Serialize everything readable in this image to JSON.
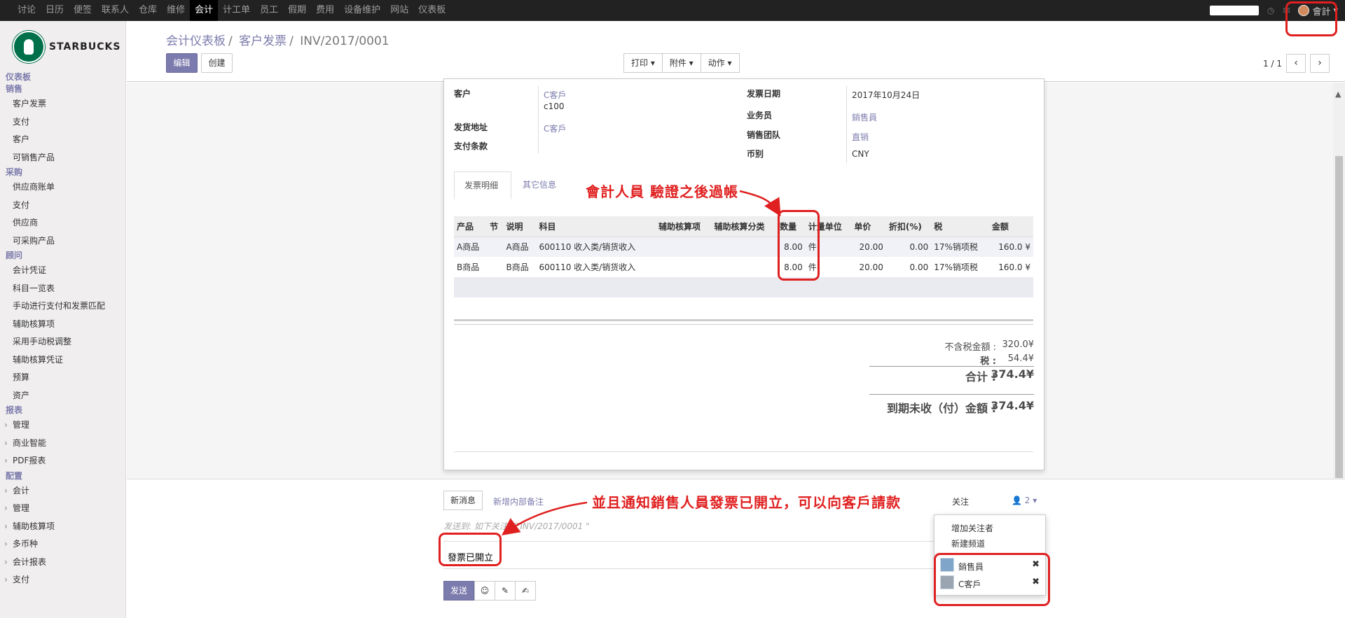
{
  "topnav": {
    "items": [
      "讨论",
      "日历",
      "便签",
      "联系人",
      "仓库",
      "维修",
      "会计",
      "计工单",
      "员工",
      "假期",
      "费用",
      "设备维护",
      "网站",
      "仪表板"
    ],
    "active_index": 6,
    "user": "會計"
  },
  "logo": {
    "text": "STARBUCKS"
  },
  "sidebar": {
    "dashboard": "仪表板",
    "sales": {
      "title": "销售",
      "items": [
        "客户发票",
        "支付",
        "客户",
        "可销售产品"
      ]
    },
    "purchase": {
      "title": "采购",
      "items": [
        "供应商账单",
        "支付",
        "供应商",
        "可采购产品"
      ]
    },
    "advisor": {
      "title": "顾问",
      "items": [
        "会计凭证",
        "科目一览表",
        "手动进行支付和发票匹配",
        "辅助核算项",
        "采用手动税调整",
        "辅助核算凭证",
        "预算",
        "资产"
      ]
    },
    "reports": {
      "title": "报表",
      "items": [
        "管理",
        "商业智能",
        "PDF报表"
      ]
    },
    "config": {
      "title": "配置",
      "items": [
        "会计",
        "管理",
        "辅助核算项",
        "多币种",
        "会计报表",
        "支付"
      ]
    }
  },
  "breadcrumb": {
    "b1": "会计仪表板",
    "b2": "客户发票",
    "current": "INV/2017/0001",
    "sep": "/"
  },
  "buttons": {
    "edit": "编辑",
    "create": "创建",
    "print": "打印 ▾",
    "attach": "附件 ▾",
    "action": "动作 ▾"
  },
  "pager": {
    "text": "1 / 1",
    "prev": "‹",
    "next": "›"
  },
  "invoice": {
    "customer_label": "客户",
    "customer_value": "C客戶",
    "customer_code": "c100",
    "ship_label": "发货地址",
    "ship_value": "C客戶",
    "payterm_label": "支付条款",
    "date_label": "发票日期",
    "date_value": "2017年10月24日",
    "salesperson_label": "业务员",
    "salesperson_value": "銷售員",
    "team_label": "销售团队",
    "team_value": "直销",
    "currency_label": "币别",
    "currency_value": "CNY"
  },
  "tabs": {
    "lines": "发票明细",
    "other": "其它信息"
  },
  "table": {
    "headers": [
      "产品",
      "节",
      "说明",
      "科目",
      "辅助核算项",
      "辅助核算分类",
      "数量",
      "计量单位",
      "单价",
      "折扣(%)",
      "税",
      "金额"
    ],
    "rows": [
      [
        "A商品",
        "",
        "A商品",
        "600110 收入类/销货收入",
        "",
        "",
        "8.00",
        "件",
        "20.00",
        "0.00",
        "17%销项税",
        "160.0 ¥"
      ],
      [
        "B商品",
        "",
        "B商品",
        "600110 收入类/销货收入",
        "",
        "",
        "8.00",
        "件",
        "20.00",
        "0.00",
        "17%销项税",
        "160.0 ¥"
      ]
    ]
  },
  "totals": {
    "untaxed_label": "不含税金額 :",
    "untaxed_value": "320.0¥",
    "tax_label": "税 :",
    "tax_value": "54.4¥",
    "total_label": "合计 :",
    "total_value": "374.4¥",
    "due_label": "到期未收（付）金額 :",
    "due_value": "374.4¥"
  },
  "chatter": {
    "new_message": "新消息",
    "internal_note": "新增内部备注",
    "follow": "关注",
    "followers_count": "2",
    "send_to": "发送到: 如下关注者\"INV/2017/0001 \"",
    "compose_text": "發票已開立",
    "send": "发送",
    "dropdown": {
      "add_follower": "增加关注者",
      "add_channel": "新建频道"
    },
    "followers": [
      "銷售員",
      "C客戶"
    ]
  },
  "annotations": {
    "a1": "會計人員 驗證之後過帳",
    "a2": "並且通知銷售人員發票已開立，可以向客戶請款"
  },
  "colors": {
    "accent": "#7c7bad",
    "annotation": "#e02020",
    "topbar": "#222222"
  }
}
